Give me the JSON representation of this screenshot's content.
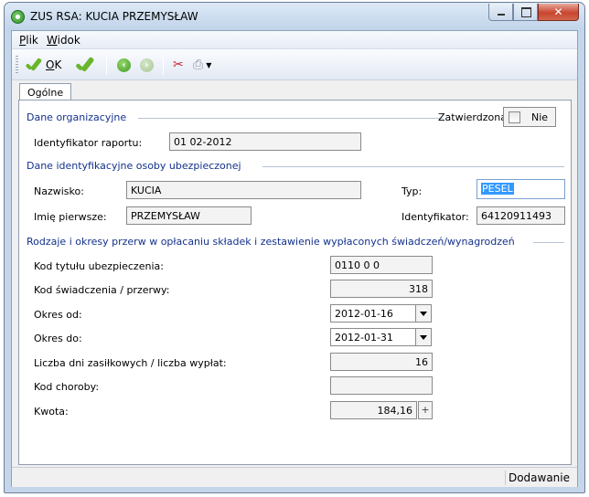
{
  "window": {
    "title": "ZUS RSA: KUCIA PRZEMYSŁAW"
  },
  "menu": [
    {
      "key": "P",
      "rest": "lik"
    },
    {
      "key": "W",
      "rest": "idok"
    }
  ],
  "toolbar": {
    "ok_key": "O",
    "ok_rest": "K"
  },
  "tabs": [
    {
      "label": "Ogólne"
    }
  ],
  "sections": {
    "org": {
      "title": "Dane organizacyjne"
    },
    "ident": {
      "title": "Dane identyfikacyjne osoby ubezpieczonej"
    },
    "breaks": {
      "title": "Rodzaje i okresy przerw w opłacaniu składek i zestawienie wypłaconych świadczeń/wynagrodzeń"
    }
  },
  "approved": {
    "label": "Zatwierdzona:",
    "checkbox_label": "Nie"
  },
  "report": {
    "label": "Identyfikator raportu:",
    "value": "01 02-2012"
  },
  "person": {
    "surname_label": "Nazwisko:",
    "surname": "KUCIA",
    "firstname_label": "Imię pierwsze:",
    "firstname": "PRZEMYSŁAW",
    "type_label": "Typ:",
    "type": "PESEL",
    "id_label": "Identyfikator:",
    "id": "64120911493"
  },
  "benefits": {
    "insurance_code_label": "Kod tytułu ubezpieczenia:",
    "insurance_code": "0110 0 0",
    "benefit_code_label": "Kod świadczenia / przerwy:",
    "benefit_code": "318",
    "from_label": "Okres od:",
    "from": "2012-01-16",
    "to_label": "Okres do:",
    "to": "2012-01-31",
    "days_label": "Liczba dni zasiłkowych / liczba wypłat:",
    "days": "16",
    "illness_label": "Kod choroby:",
    "illness": "",
    "amount_label": "Kwota:",
    "amount": "184,16"
  },
  "status": {
    "mode": "Dodawanie"
  },
  "icons": [
    "app-icon",
    "ok-check-icon",
    "check-icon",
    "back-arrow-icon",
    "forward-arrow-icon",
    "tools-icon",
    "printer-icon",
    "dropdown-arrow-icon",
    "minimize-icon",
    "maximize-icon",
    "close-icon"
  ]
}
